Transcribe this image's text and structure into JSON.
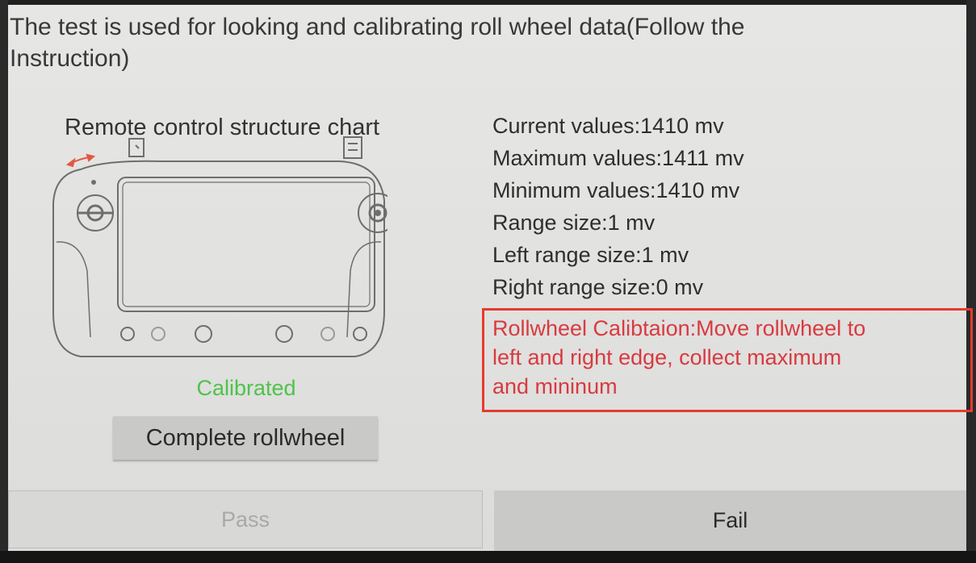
{
  "header": {
    "instruction_line1": "The test is used for looking and calibrating roll wheel data(Follow the",
    "instruction_line2": "Instruction)"
  },
  "diagram": {
    "title": "Remote control structure chart"
  },
  "values": {
    "current": "Current values:1410 mv",
    "maximum": "Maximum values:1411 mv",
    "minimum": "Minimum values:1410 mv",
    "range": "Range size:1 mv",
    "left_range": "Left range size:1 mv",
    "right_range": "Right range size:0 mv"
  },
  "calibration": {
    "line1": "Rollwheel Calibtaion:Move rollwheel to",
    "line2": "left and right edge, collect maximum",
    "line3": "and mininum"
  },
  "status": {
    "label": "Calibrated",
    "color": "#4ec34b"
  },
  "buttons": {
    "complete": "Complete rollwheel",
    "pass": "Pass",
    "fail": "Fail"
  },
  "colors": {
    "highlight_border": "#e53b2f",
    "highlight_text": "#d83a40",
    "arrow": "#e4573f"
  }
}
